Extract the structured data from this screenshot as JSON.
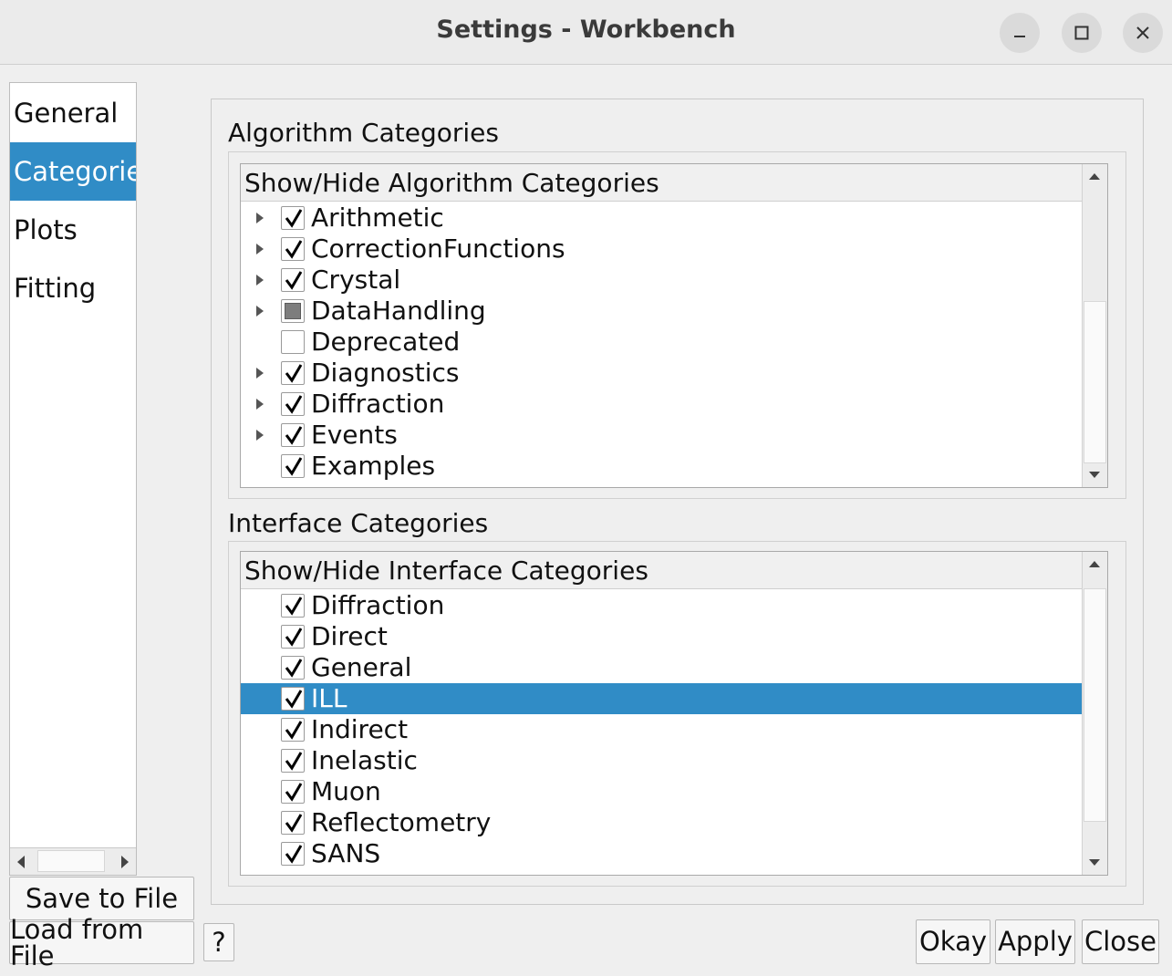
{
  "window": {
    "title": "Settings - Workbench"
  },
  "nav": {
    "items": [
      {
        "label": "General",
        "selected": false
      },
      {
        "label": "Categories",
        "selected": true
      },
      {
        "label": "Plots",
        "selected": false
      },
      {
        "label": "Fitting",
        "selected": false
      }
    ]
  },
  "buttons": {
    "save_to_file": "Save to File",
    "load_from_file": "Load from File",
    "help": "?",
    "okay": "Okay",
    "apply": "Apply",
    "close": "Close"
  },
  "algorithm_group": {
    "label": "Algorithm Categories",
    "header": "Show/Hide Algorithm Categories",
    "items": [
      {
        "label": "Arithmetic",
        "state": "checked",
        "expandable": true
      },
      {
        "label": "CorrectionFunctions",
        "state": "checked",
        "expandable": true
      },
      {
        "label": "Crystal",
        "state": "checked",
        "expandable": true
      },
      {
        "label": "DataHandling",
        "state": "partial",
        "expandable": true
      },
      {
        "label": "Deprecated",
        "state": "unchecked",
        "expandable": false
      },
      {
        "label": "Diagnostics",
        "state": "checked",
        "expandable": true
      },
      {
        "label": "Diffraction",
        "state": "checked",
        "expandable": true
      },
      {
        "label": "Events",
        "state": "checked",
        "expandable": true
      },
      {
        "label": "Examples",
        "state": "checked",
        "expandable": false
      }
    ]
  },
  "interface_group": {
    "label": "Interface Categories",
    "header": "Show/Hide Interface Categories",
    "items": [
      {
        "label": "Diffraction",
        "state": "checked",
        "selected": false
      },
      {
        "label": "Direct",
        "state": "checked",
        "selected": false
      },
      {
        "label": "General",
        "state": "checked",
        "selected": false
      },
      {
        "label": "ILL",
        "state": "checked",
        "selected": true
      },
      {
        "label": "Indirect",
        "state": "checked",
        "selected": false
      },
      {
        "label": "Inelastic",
        "state": "checked",
        "selected": false
      },
      {
        "label": "Muon",
        "state": "checked",
        "selected": false
      },
      {
        "label": "Reflectometry",
        "state": "checked",
        "selected": false
      },
      {
        "label": "SANS",
        "state": "checked",
        "selected": false
      }
    ]
  },
  "colors": {
    "selection": "#308cc6",
    "window_bg": "#efefef"
  }
}
